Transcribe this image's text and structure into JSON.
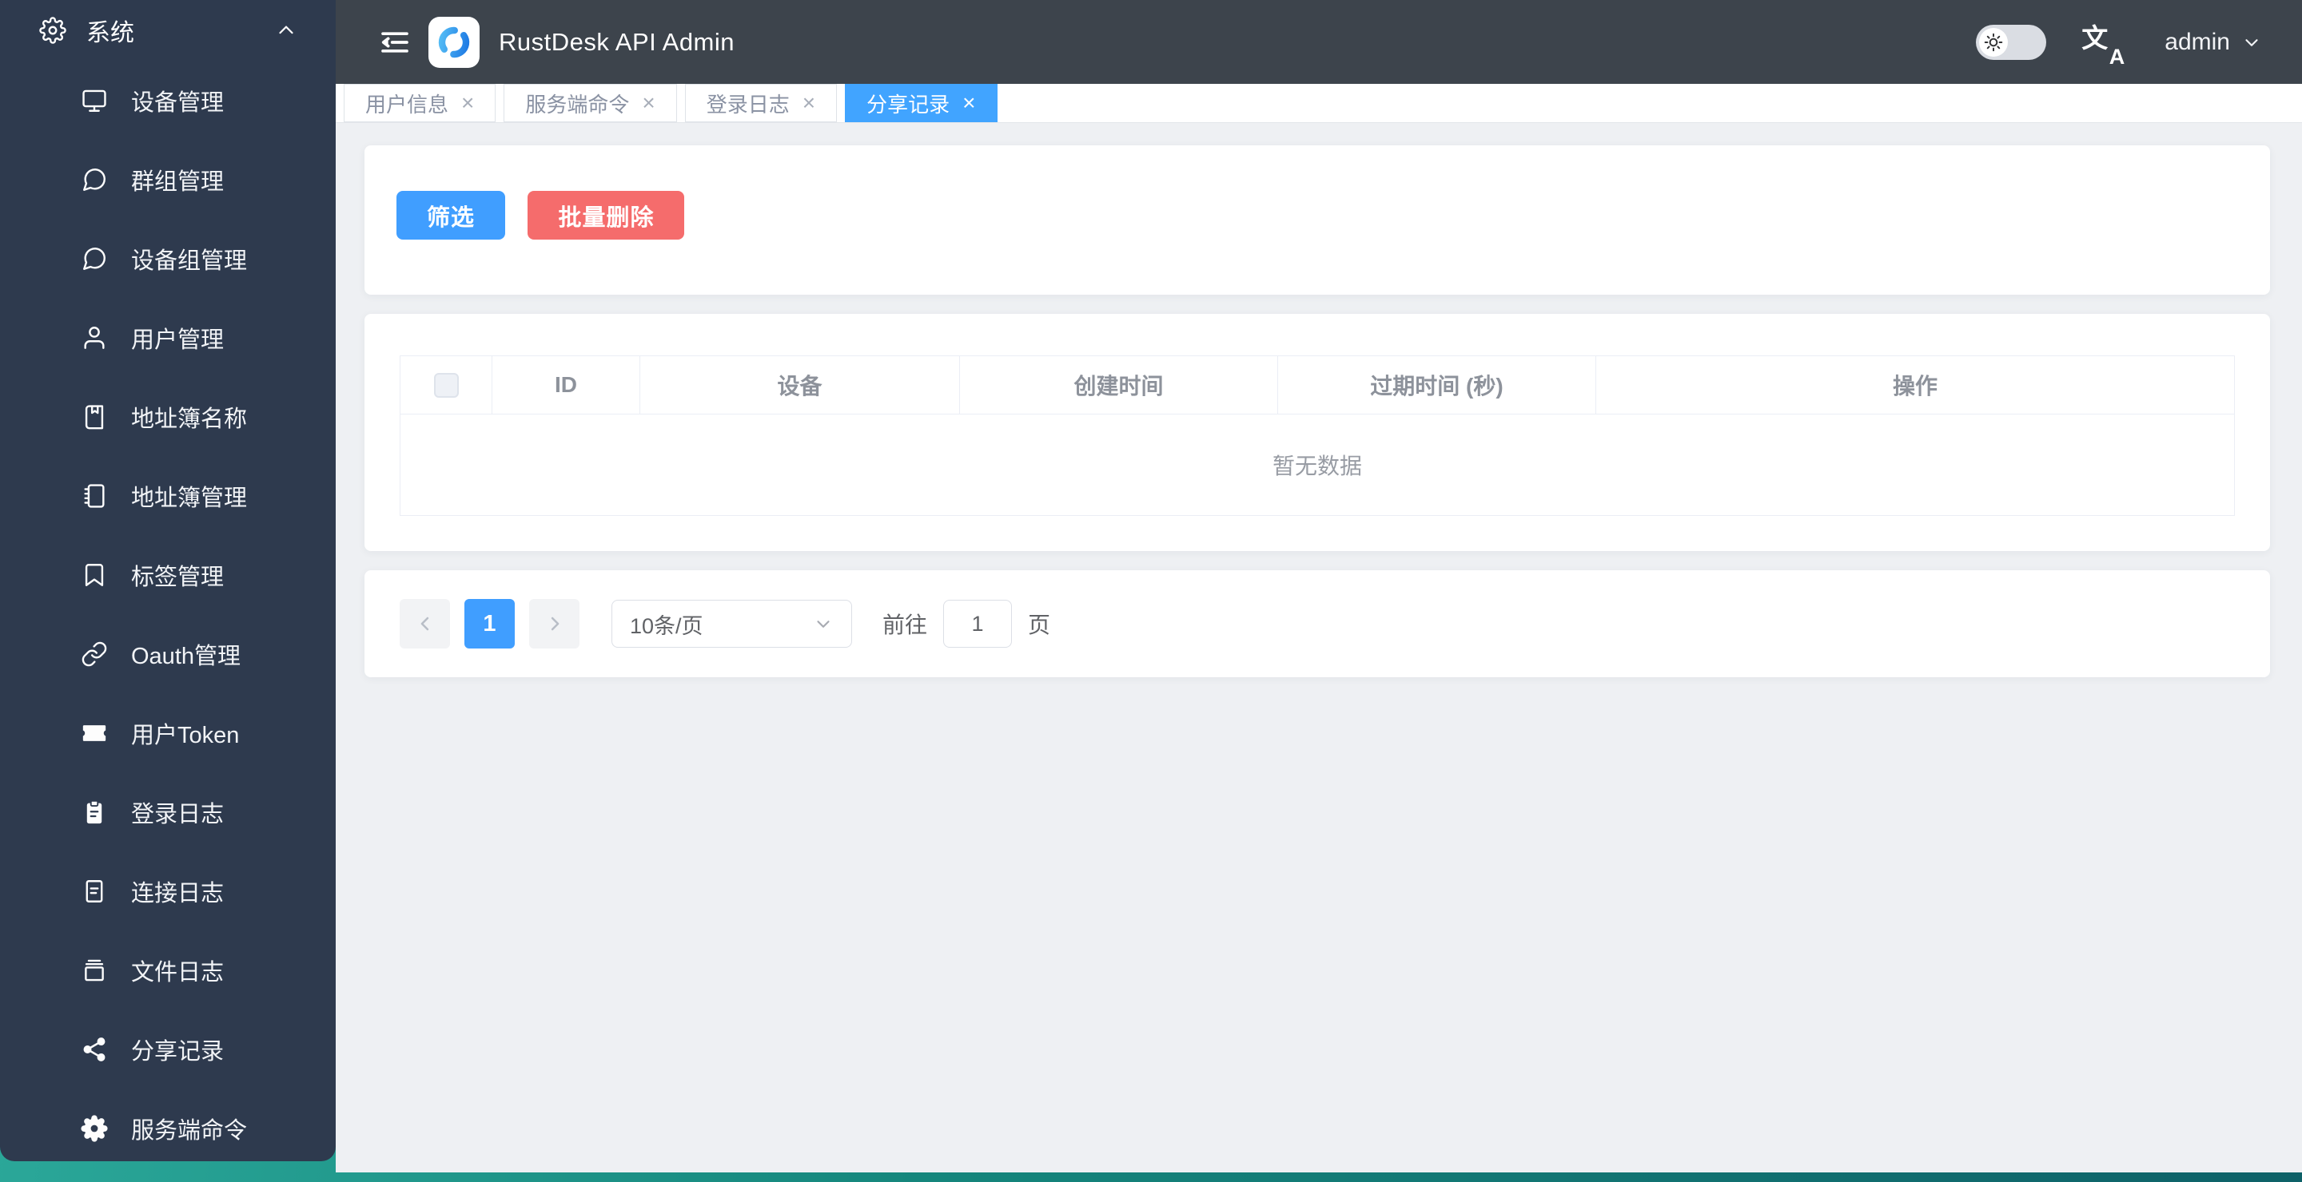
{
  "header": {
    "app_title": "RustDesk API Admin",
    "user": "admin"
  },
  "sidebar": {
    "section": {
      "label": "系统",
      "icon": "gear-icon"
    },
    "items": [
      {
        "label": "设备管理",
        "icon": "monitor-icon"
      },
      {
        "label": "群组管理",
        "icon": "chat-bubble-icon"
      },
      {
        "label": "设备组管理",
        "icon": "chat-bubble-icon"
      },
      {
        "label": "用户管理",
        "icon": "user-icon"
      },
      {
        "label": "地址簿名称",
        "icon": "book-bookmark-icon"
      },
      {
        "label": "地址簿管理",
        "icon": "notebook-icon"
      },
      {
        "label": "标签管理",
        "icon": "bookmark-icon"
      },
      {
        "label": "Oauth管理",
        "icon": "link-icon"
      },
      {
        "label": "用户Token",
        "icon": "ticket-icon"
      },
      {
        "label": "登录日志",
        "icon": "clipboard-icon"
      },
      {
        "label": "连接日志",
        "icon": "document-icon"
      },
      {
        "label": "文件日志",
        "icon": "archive-icon"
      },
      {
        "label": "分享记录",
        "icon": "share-icon"
      },
      {
        "label": "服务端命令",
        "icon": "gear-filled-icon"
      }
    ]
  },
  "tabs": [
    {
      "label": "用户信息",
      "active": false
    },
    {
      "label": "服务端命令",
      "active": false
    },
    {
      "label": "登录日志",
      "active": false
    },
    {
      "label": "分享记录",
      "active": true
    }
  ],
  "toolbar": {
    "filter_label": "筛选",
    "batch_delete_label": "批量删除"
  },
  "table": {
    "columns": [
      "ID",
      "设备",
      "创建时间",
      "过期时间 (秒)",
      "操作"
    ],
    "empty_text": "暂无数据"
  },
  "pagination": {
    "current_page": "1",
    "page_size_label": "10条/页",
    "goto_label": "前往",
    "goto_value": "1",
    "page_unit_label": "页"
  },
  "colors": {
    "primary": "#409eff",
    "danger": "#f56c6c",
    "sidebar_bg": "#2e3a4e",
    "header_bg": "#3d444c",
    "active_tab": "#41a4ff",
    "accent_teal": "#15867c"
  }
}
